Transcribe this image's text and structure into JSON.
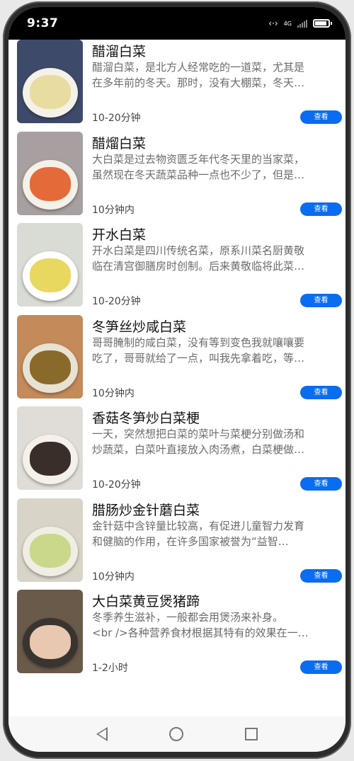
{
  "status_bar": {
    "time": "9:37",
    "signal_text": "4G"
  },
  "recipes": [
    {
      "title": "醋溜白菜",
      "desc_line1": "醋溜白菜，是北方人经常吃的一道菜，尤其是",
      "desc_line2": "在多年前的冬天。那时，没有大棚菜，冬天…",
      "time": "10-20分钟",
      "button": "查看"
    },
    {
      "title": "醋熘白菜",
      "desc_line1": "大白菜是过去物资匮乏年代冬天里的当家菜，",
      "desc_line2": "虽然现在冬天蔬菜品种一点也不少了，但是…",
      "time": "10分钟内",
      "button": "查看"
    },
    {
      "title": "开水白菜",
      "desc_line1": "开水白菜是四川传统名菜，原系川菜名厨黄敬",
      "desc_line2": "临在清宫御膳房时创制。后来黄敬临将此菜…",
      "time": "10-20分钟",
      "button": "查看"
    },
    {
      "title": "冬笋丝炒咸白菜",
      "desc_line1": "哥哥腌制的咸白菜，没有等到变色我就嚷嚷要",
      "desc_line2": "吃了，哥哥就给了一点，叫我先拿着吃，等…",
      "time": "10分钟内",
      "button": "查看"
    },
    {
      "title": "香菇冬笋炒白菜梗",
      "desc_line1": "一天，突然想把白菜的菜叶与菜梗分别做汤和",
      "desc_line2": "炒蔬菜，白菜叶直接放入肉汤煮，白菜梗做…",
      "time": "10-20分钟",
      "button": "查看"
    },
    {
      "title": "腊肠炒金针蘑白菜",
      "desc_line1": "金针菇中含锌量比较高，有促进儿童智力发育",
      "desc_line2": "和健脑的作用，在许多国家被誉为“益智…",
      "time": "10分钟内",
      "button": "查看"
    },
    {
      "title": "大白菜黄豆煲猪蹄",
      "desc_line1": "冬季养生滋补，一般都会用煲汤来补身。",
      "desc_line2": "<br />各种营养食材根据其特有的效果在一…",
      "time": "1-2小时",
      "button": "查看"
    }
  ],
  "colors": {
    "accent": "#0a6cf0",
    "status_bar_bg": "#000000"
  },
  "icons": [
    "data-transfer-icon",
    "signal-icon",
    "battery-icon",
    "back-icon",
    "home-icon",
    "recent-apps-icon"
  ]
}
